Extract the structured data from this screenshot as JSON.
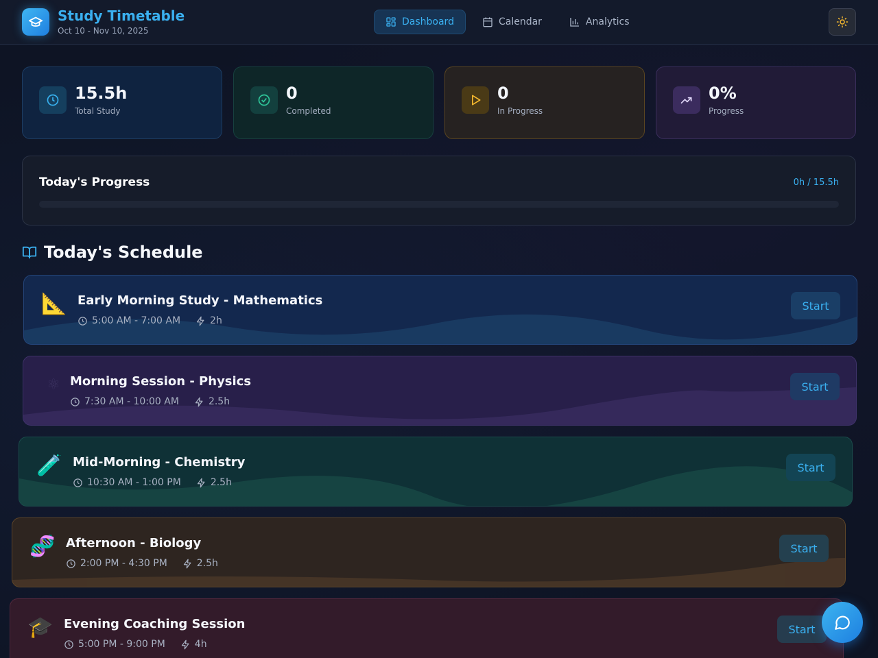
{
  "header": {
    "title": "Study Timetable",
    "date_range": "Oct 10 - Nov 10, 2025",
    "nav": [
      {
        "label": "Dashboard",
        "active": true,
        "icon": "dashboard-icon"
      },
      {
        "label": "Calendar",
        "active": false,
        "icon": "calendar-icon"
      },
      {
        "label": "Analytics",
        "active": false,
        "icon": "bar-chart-icon"
      }
    ],
    "theme_icon": "sun-icon"
  },
  "stats": [
    {
      "value": "15.5h",
      "label": "Total Study",
      "icon": "clock-icon",
      "color": "#38b2f0"
    },
    {
      "value": "0",
      "label": "Completed",
      "icon": "check-circle-icon",
      "color": "#2fc79a"
    },
    {
      "value": "0",
      "label": "In Progress",
      "icon": "play-icon",
      "color": "#f5b82e"
    },
    {
      "value": "0%",
      "label": "Progress",
      "icon": "trending-up-icon",
      "color": "#c9b8f5"
    }
  ],
  "progress": {
    "title": "Today's Progress",
    "value_text": "0h / 15.5h",
    "fraction": 0
  },
  "schedule": {
    "title": "Today's Schedule",
    "icon": "book-open-icon",
    "start_label": "Start",
    "sessions": [
      {
        "emoji": "📐",
        "title": "Early Morning Study - Mathematics",
        "time": "5:00 AM - 7:00 AM",
        "duration": "2h"
      },
      {
        "emoji": "⚛",
        "title": "Morning Session - Physics",
        "time": "7:30 AM - 10:00 AM",
        "duration": "2.5h"
      },
      {
        "emoji": "🧪",
        "title": "Mid-Morning - Chemistry",
        "time": "10:30 AM - 1:00 PM",
        "duration": "2.5h"
      },
      {
        "emoji": "🧬",
        "title": "Afternoon - Biology",
        "time": "2:00 PM - 4:30 PM",
        "duration": "2.5h"
      },
      {
        "emoji": "🎓",
        "title": "Evening Coaching Session",
        "time": "5:00 PM - 9:00 PM",
        "duration": "4h"
      }
    ]
  },
  "colors": {
    "accent": "#3ab0f0",
    "background": "#0e1424"
  }
}
